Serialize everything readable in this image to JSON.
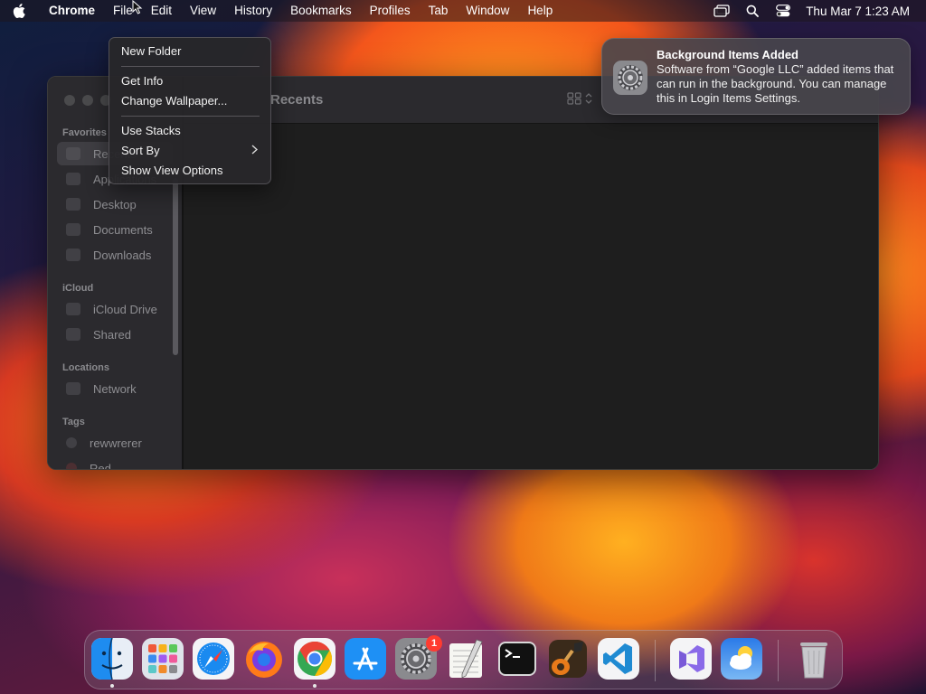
{
  "menubar": {
    "app_name": "Chrome",
    "menus": [
      "File",
      "Edit",
      "View",
      "History",
      "Bookmarks",
      "Profiles",
      "Tab",
      "Window",
      "Help"
    ],
    "clock": "Thu Mar 7  1:23 AM"
  },
  "context_menu": {
    "new_folder": "New Folder",
    "get_info": "Get Info",
    "change_wallpaper": "Change Wallpaper...",
    "use_stacks": "Use Stacks",
    "sort_by": "Sort By",
    "show_view_options": "Show View Options"
  },
  "notification": {
    "title": "Background Items Added",
    "body": "Software from “Google LLC” added items that can run in the background. You can manage this in Login Items Settings."
  },
  "finder": {
    "window_title": "Recents",
    "sidebar": {
      "favorites_header": "Favorites",
      "icloud_header": "iCloud",
      "locations_header": "Locations",
      "tags_header": "Tags",
      "recents": "Recents",
      "applications": "Applications",
      "desktop": "Desktop",
      "documents": "Documents",
      "downloads": "Downloads",
      "icloud_drive": "iCloud Drive",
      "shared": "Shared",
      "network": "Network",
      "tag_1": "rewwrerer",
      "tag_2": "Red"
    }
  },
  "dock": {
    "apps": [
      "Finder",
      "Launchpad",
      "Safari",
      "Firefox",
      "Google Chrome",
      "App Store",
      "System Settings",
      "TextEdit",
      "Terminal",
      "GarageBand",
      "Visual Studio Code",
      "Visual Studio",
      "Weather",
      "Trash"
    ],
    "system_settings_badge": "1"
  },
  "colors": {
    "menubar_bg": "#1e161e",
    "finder_bg": "#1f1f1f",
    "notification_bg": "#48464c",
    "badge_red": "#ff3b30"
  }
}
